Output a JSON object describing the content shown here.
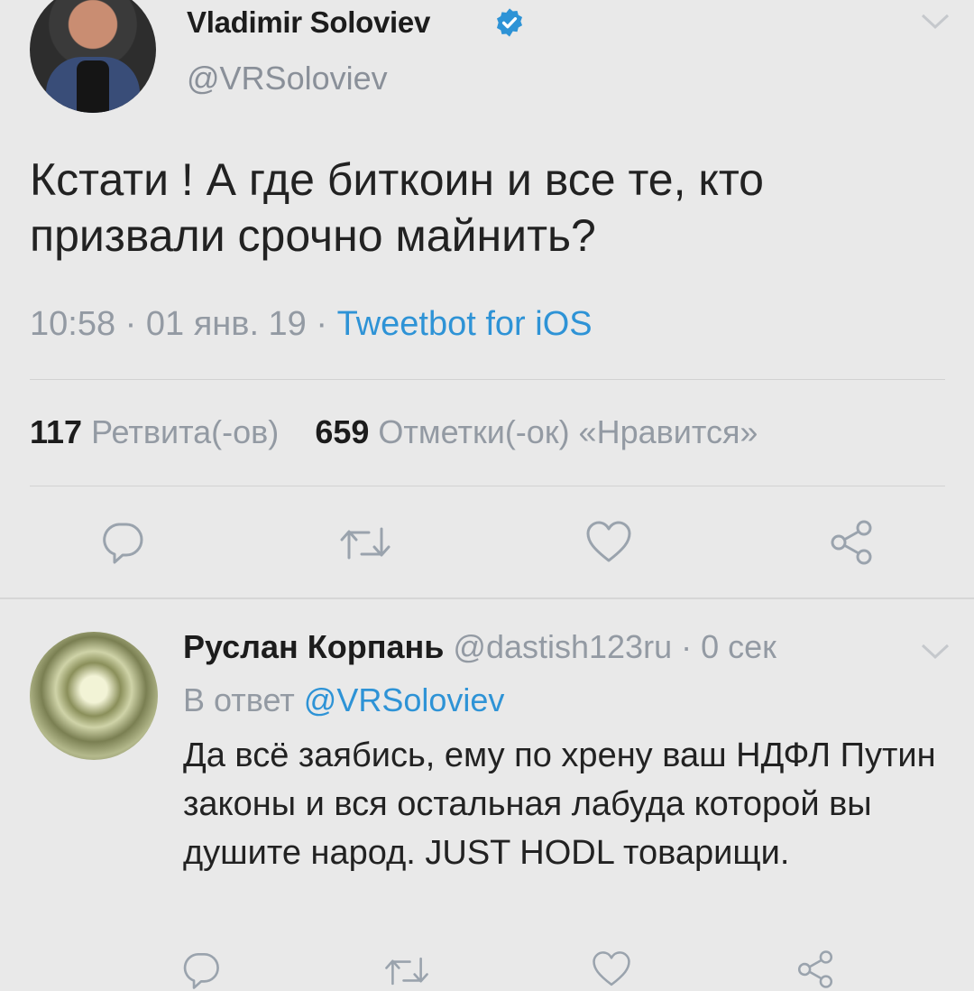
{
  "tweet": {
    "author_name": "Vladimir Soloviev",
    "author_handle": "@VRSoloviev",
    "text": "Кстати ! А где биткоин и все те, кто призвали срочно майнить?",
    "time": "10:58 · 01 янв. 19 · ",
    "app": "Tweetbot for iOS",
    "retweet_count": "117",
    "retweet_label": "Ретвита(-ов)",
    "like_count": "659",
    "like_label": "Отметки(-ок) «Нравится»"
  },
  "reply": {
    "author_name": "Руслан Корпань",
    "author_meta": "@dastish123ru · 0 сек",
    "reply_prefix": "В ответ ",
    "reply_target": "@VRSoloviev",
    "text": "Да всё заябись, ему по хрену ваш НДФЛ Путин законы и вся остальная лабуда которой вы душите народ. JUST HODL товарищи."
  },
  "colors": {
    "link": "#2e93d6",
    "muted": "#939aa3",
    "background": "#e9e9e9"
  },
  "icons": [
    "verified-badge-icon",
    "chevron-down-icon",
    "reply-icon",
    "retweet-icon",
    "like-icon",
    "share-icon"
  ]
}
